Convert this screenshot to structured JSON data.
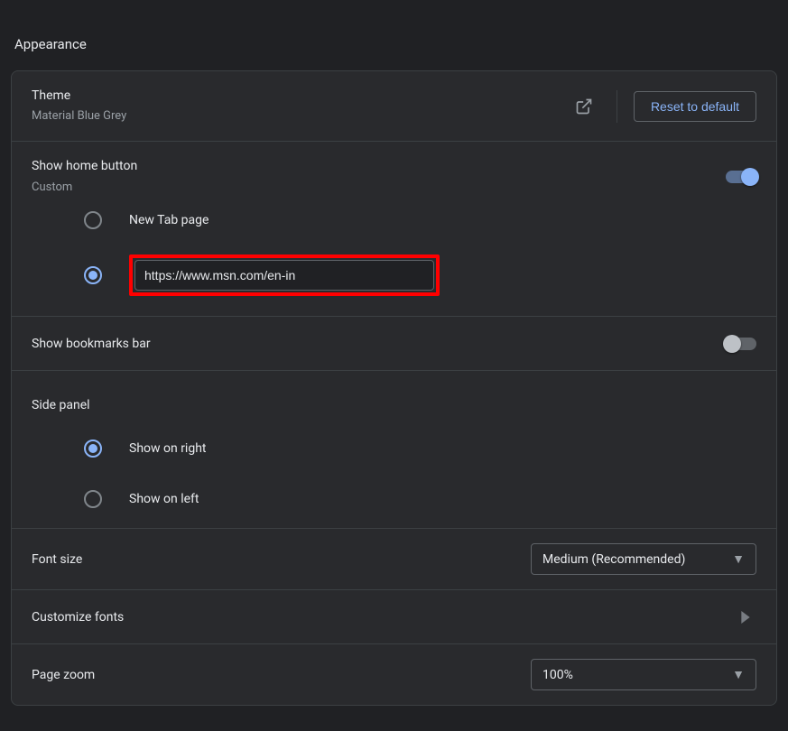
{
  "header": "Appearance",
  "theme": {
    "title": "Theme",
    "value": "Material Blue Grey",
    "reset_button": "Reset to default"
  },
  "home_button": {
    "title": "Show home button",
    "subtitle": "Custom",
    "enabled": true,
    "options": {
      "new_tab": "New Tab page",
      "custom_url_value": "https://www.msn.com/en-in"
    }
  },
  "bookmarks_bar": {
    "title": "Show bookmarks bar",
    "enabled": false
  },
  "side_panel": {
    "title": "Side panel",
    "options": {
      "right": "Show on right",
      "left": "Show on left"
    }
  },
  "font_size": {
    "title": "Font size",
    "value": "Medium (Recommended)"
  },
  "customize_fonts": {
    "title": "Customize fonts"
  },
  "page_zoom": {
    "title": "Page zoom",
    "value": "100%"
  }
}
